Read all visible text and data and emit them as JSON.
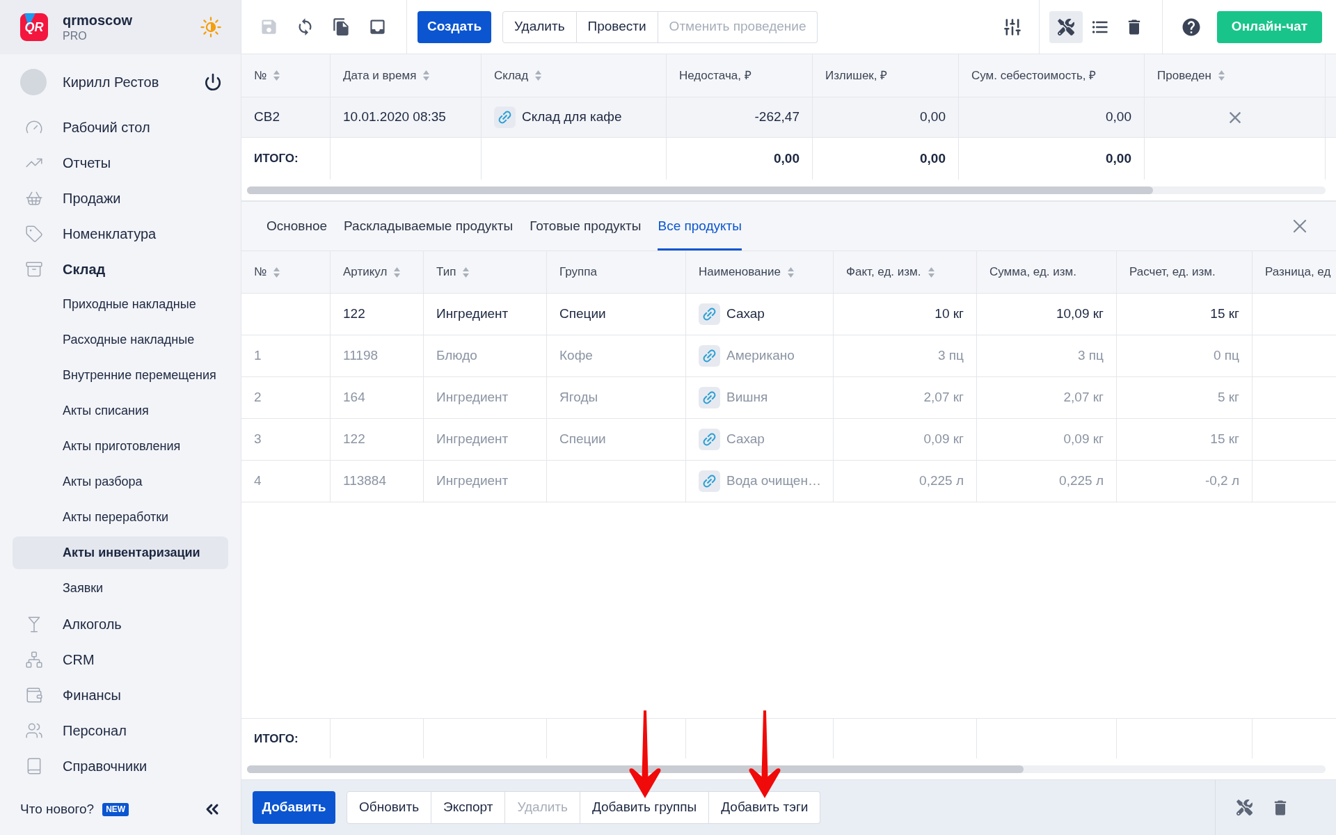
{
  "brand": {
    "logo_text": "QR",
    "name": "qrmoscow",
    "plan": "PRO"
  },
  "user": {
    "name": "Кирилл Рестов"
  },
  "sidebar": {
    "items": [
      {
        "label": "Рабочий стол",
        "selected": false
      },
      {
        "label": "Отчеты",
        "selected": false
      },
      {
        "label": "Продажи",
        "selected": false
      },
      {
        "label": "Номенклатура",
        "selected": false
      },
      {
        "label": "Склад",
        "selected": true,
        "children": [
          {
            "label": "Приходные накладные",
            "selected": false
          },
          {
            "label": "Расходные накладные",
            "selected": false
          },
          {
            "label": "Внутренние перемещения",
            "selected": false
          },
          {
            "label": "Акты списания",
            "selected": false
          },
          {
            "label": "Акты приготовления",
            "selected": false
          },
          {
            "label": "Акты разбора",
            "selected": false
          },
          {
            "label": "Акты переработки",
            "selected": false
          },
          {
            "label": "Акты инвентаризации",
            "selected": true
          },
          {
            "label": "Заявки",
            "selected": false
          }
        ]
      },
      {
        "label": "Алкоголь",
        "selected": false
      },
      {
        "label": "CRM",
        "selected": false
      },
      {
        "label": "Финансы",
        "selected": false
      },
      {
        "label": "Персонал",
        "selected": false
      },
      {
        "label": "Справочники",
        "selected": false
      }
    ],
    "footer": {
      "label": "Что нового?",
      "badge": "NEW"
    }
  },
  "toolbar": {
    "file_buttons": [
      {
        "disabled": true
      },
      {
        "disabled": false
      },
      {
        "disabled": false
      },
      {
        "disabled": false
      }
    ],
    "create_button": "Создать",
    "actions": [
      {
        "label": "Удалить",
        "disabled": false
      },
      {
        "label": "Провести",
        "disabled": false
      },
      {
        "label": "Отменить проведение",
        "disabled": true
      }
    ],
    "tools": [
      {
        "active": true
      },
      {
        "active": false
      },
      {
        "active": false
      }
    ],
    "chat_button": "Онлайн-чат"
  },
  "document_table": {
    "columns": [
      {
        "label": "№",
        "sortable": true,
        "kind": "text"
      },
      {
        "label": "Дата и время",
        "sortable": true,
        "kind": "text"
      },
      {
        "label": "Склад",
        "sortable": true,
        "kind": "link"
      },
      {
        "label": "Недостача, ₽",
        "sortable": false,
        "kind": "number",
        "total": "0,00"
      },
      {
        "label": "Излишек, ₽",
        "sortable": false,
        "kind": "number",
        "total": "0,00"
      },
      {
        "label": "Сум. себестоимость, ₽",
        "sortable": false,
        "kind": "number",
        "total": "0,00"
      },
      {
        "label": "Проведен",
        "sortable": true,
        "kind": "status"
      }
    ],
    "rows": [
      {
        "cells": [
          "СВ2",
          "10.01.2020 08:35",
          "Склад для кафе",
          "-262,47",
          "0,00",
          "0,00"
        ],
        "posted": false,
        "selected": true
      }
    ],
    "total_label": "ИТОГО:"
  },
  "tabs": [
    {
      "label": "Основное",
      "selected": false
    },
    {
      "label": "Раскладываемые продукты",
      "selected": false
    },
    {
      "label": "Готовые продукты",
      "selected": false
    },
    {
      "label": "Все продукты",
      "selected": true
    }
  ],
  "detail_table": {
    "columns": [
      {
        "label": "№",
        "sortable": true,
        "kind": "text"
      },
      {
        "label": "Артикул",
        "sortable": true,
        "kind": "text"
      },
      {
        "label": "Тип",
        "sortable": true,
        "kind": "text"
      },
      {
        "label": "Группа",
        "sortable": false,
        "kind": "text"
      },
      {
        "label": "Наименование",
        "sortable": true,
        "kind": "link"
      },
      {
        "label": "Факт, ед. изм.",
        "sortable": true,
        "kind": "number"
      },
      {
        "label": "Сумма, ед. изм.",
        "sortable": false,
        "kind": "number"
      },
      {
        "label": "Расчет, ед. изм.",
        "sortable": false,
        "kind": "number"
      },
      {
        "label": "Разница, ед",
        "sortable": false,
        "kind": "number"
      }
    ],
    "rows": [
      {
        "cells": [
          null,
          "122",
          "Ингредиент",
          "Специи",
          "Сахар",
          "10 кг",
          "10,09 кг",
          "15 кг"
        ],
        "dimmed": false
      },
      {
        "cells": [
          "1",
          "11198",
          "Блюдо",
          "Кофе",
          "Американо",
          "3 пц",
          "3 пц",
          "0 пц"
        ],
        "dimmed": true
      },
      {
        "cells": [
          "2",
          "164",
          "Ингредиент",
          "Ягоды",
          "Вишня",
          "2,07 кг",
          "2,07 кг",
          "5 кг"
        ],
        "dimmed": true
      },
      {
        "cells": [
          "3",
          "122",
          "Ингредиент",
          "Специи",
          "Сахар",
          "0,09 кг",
          "0,09 кг",
          "15 кг"
        ],
        "dimmed": true
      },
      {
        "cells": [
          "4",
          "113884",
          "Ингредиент",
          null,
          "Вода очищен…",
          "0,225 л",
          "0,225 л",
          "-0,2 л"
        ],
        "dimmed": true
      }
    ],
    "total_label": "ИТОГО:"
  },
  "bottom_toolbar": {
    "add_button": "Добавить",
    "actions": [
      {
        "label": "Обновить",
        "disabled": false,
        "arrow": false
      },
      {
        "label": "Экспорт",
        "disabled": false,
        "arrow": false
      },
      {
        "label": "Удалить",
        "disabled": true,
        "arrow": false
      },
      {
        "label": "Добавить группы",
        "disabled": false,
        "arrow": true
      },
      {
        "label": "Добавить тэги",
        "disabled": false,
        "arrow": true
      }
    ]
  }
}
